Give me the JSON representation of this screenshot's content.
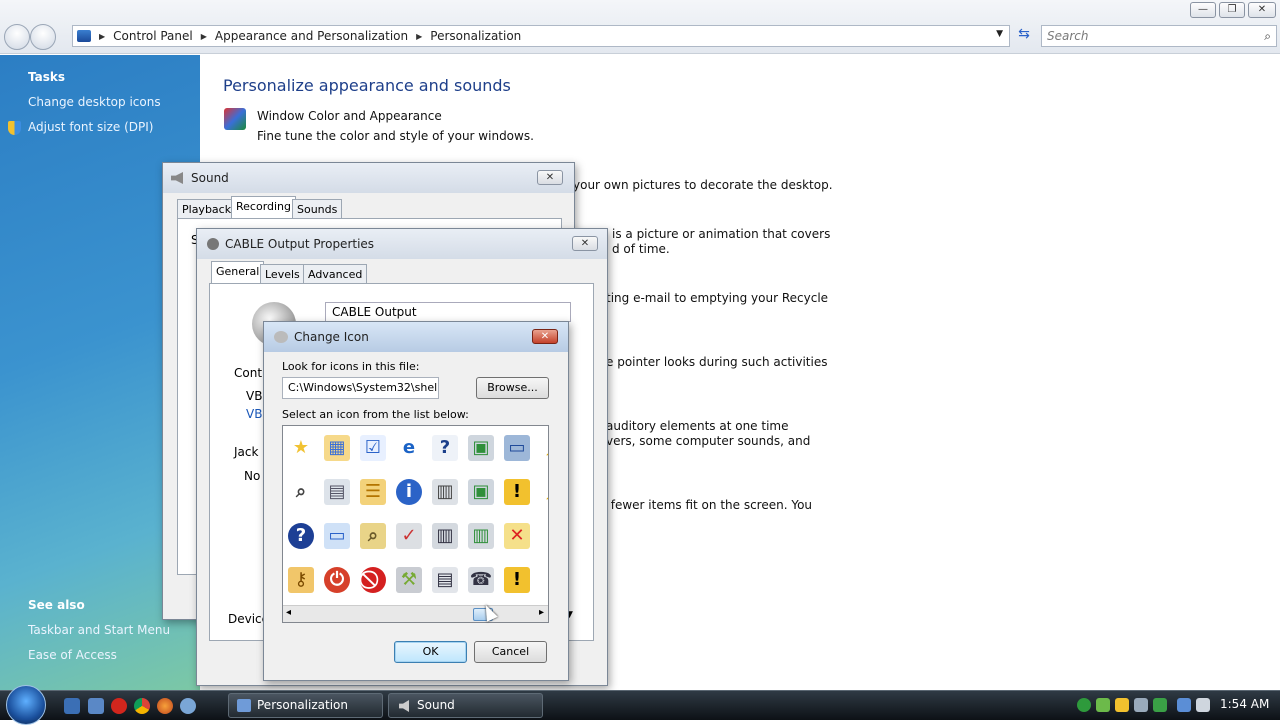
{
  "window_controls": {
    "minimize": "—",
    "restore": "❐",
    "close": "✕"
  },
  "address": {
    "crumbs": [
      "Control Panel",
      "Appearance and Personalization",
      "Personalization"
    ]
  },
  "search": {
    "placeholder": "Search"
  },
  "tasks": {
    "title": "Tasks",
    "items": [
      "Change desktop icons",
      "Adjust font size (DPI)"
    ],
    "see_also_title": "See also",
    "see_also": [
      "Taskbar and Start Menu",
      "Ease of Access"
    ]
  },
  "main": {
    "title": "Personalize appearance and sounds",
    "items": [
      {
        "link": "Window Color and Appearance",
        "desc": "Fine tune the color and style of your windows."
      }
    ],
    "fragments": [
      "your own pictures to decorate the desktop.",
      "is a picture or animation that covers",
      "d of time.",
      "ting e-mail to emptying your Recycle",
      "e pointer looks during such activities",
      "auditory elements at one time",
      "vers, some computer sounds, and",
      "r fewer items fit on the screen. You"
    ]
  },
  "sound_dialog": {
    "title": "Sound",
    "close": "✕",
    "tabs": [
      "Playback",
      "Recording",
      "Sounds"
    ],
    "partial": "S"
  },
  "cable_dialog": {
    "title": "CABLE Output Properties",
    "close": "✕",
    "tabs": [
      "General",
      "Levels",
      "Advanced"
    ],
    "device_name": "CABLE Output",
    "controller_label": "Contr",
    "controller_line1": "VB-",
    "controller_line2": "VB-",
    "jack_label": "Jack I",
    "jack_value": "No",
    "device_label": "Device"
  },
  "change_icon": {
    "title": "Change Icon",
    "close": "✕",
    "file_label": "Look for icons in this file:",
    "file_value": "C:\\Windows\\System32\\shell32.dll",
    "browse": "Browse...",
    "list_label": "Select an icon from the list below:",
    "ok": "OK",
    "cancel": "Cancel",
    "scroll_left": "◂",
    "scroll_right": "▸",
    "icons": [
      [
        "star-icon",
        "folder-calendar-icon",
        "checklist-icon",
        "internet-explorer-icon",
        "help-document-icon",
        "network-printer-icon",
        "computer-monitor-icon",
        "warning-partial-icon"
      ],
      [
        "magnifier-icon",
        "scanner-icon",
        "stacked-documents-icon",
        "info-icon",
        "printer-icon",
        "network-printer-icon",
        "warning-icon",
        "warning-partial-icon"
      ],
      [
        "help-icon",
        "window-icon",
        "search-network-icon",
        "printer-check-icon",
        "printer-network-icon",
        "printer-network-2-icon",
        "document-delete-icon",
        "partial-icon"
      ],
      [
        "key-icon",
        "power-icon",
        "blocked-icon",
        "tools-icon",
        "fax-printer-icon",
        "fax-icon",
        "warning-icon",
        "folder-partial-icon"
      ]
    ]
  },
  "taskbar": {
    "buttons": [
      "Personalization",
      "Sound"
    ],
    "clock": "1:54 AM"
  },
  "colors": {
    "link": "#1a57b8",
    "title_blue": "#1e3f8a",
    "task_pane_top": "#2c7ec4",
    "task_pane_bottom": "#7cc8a5"
  }
}
